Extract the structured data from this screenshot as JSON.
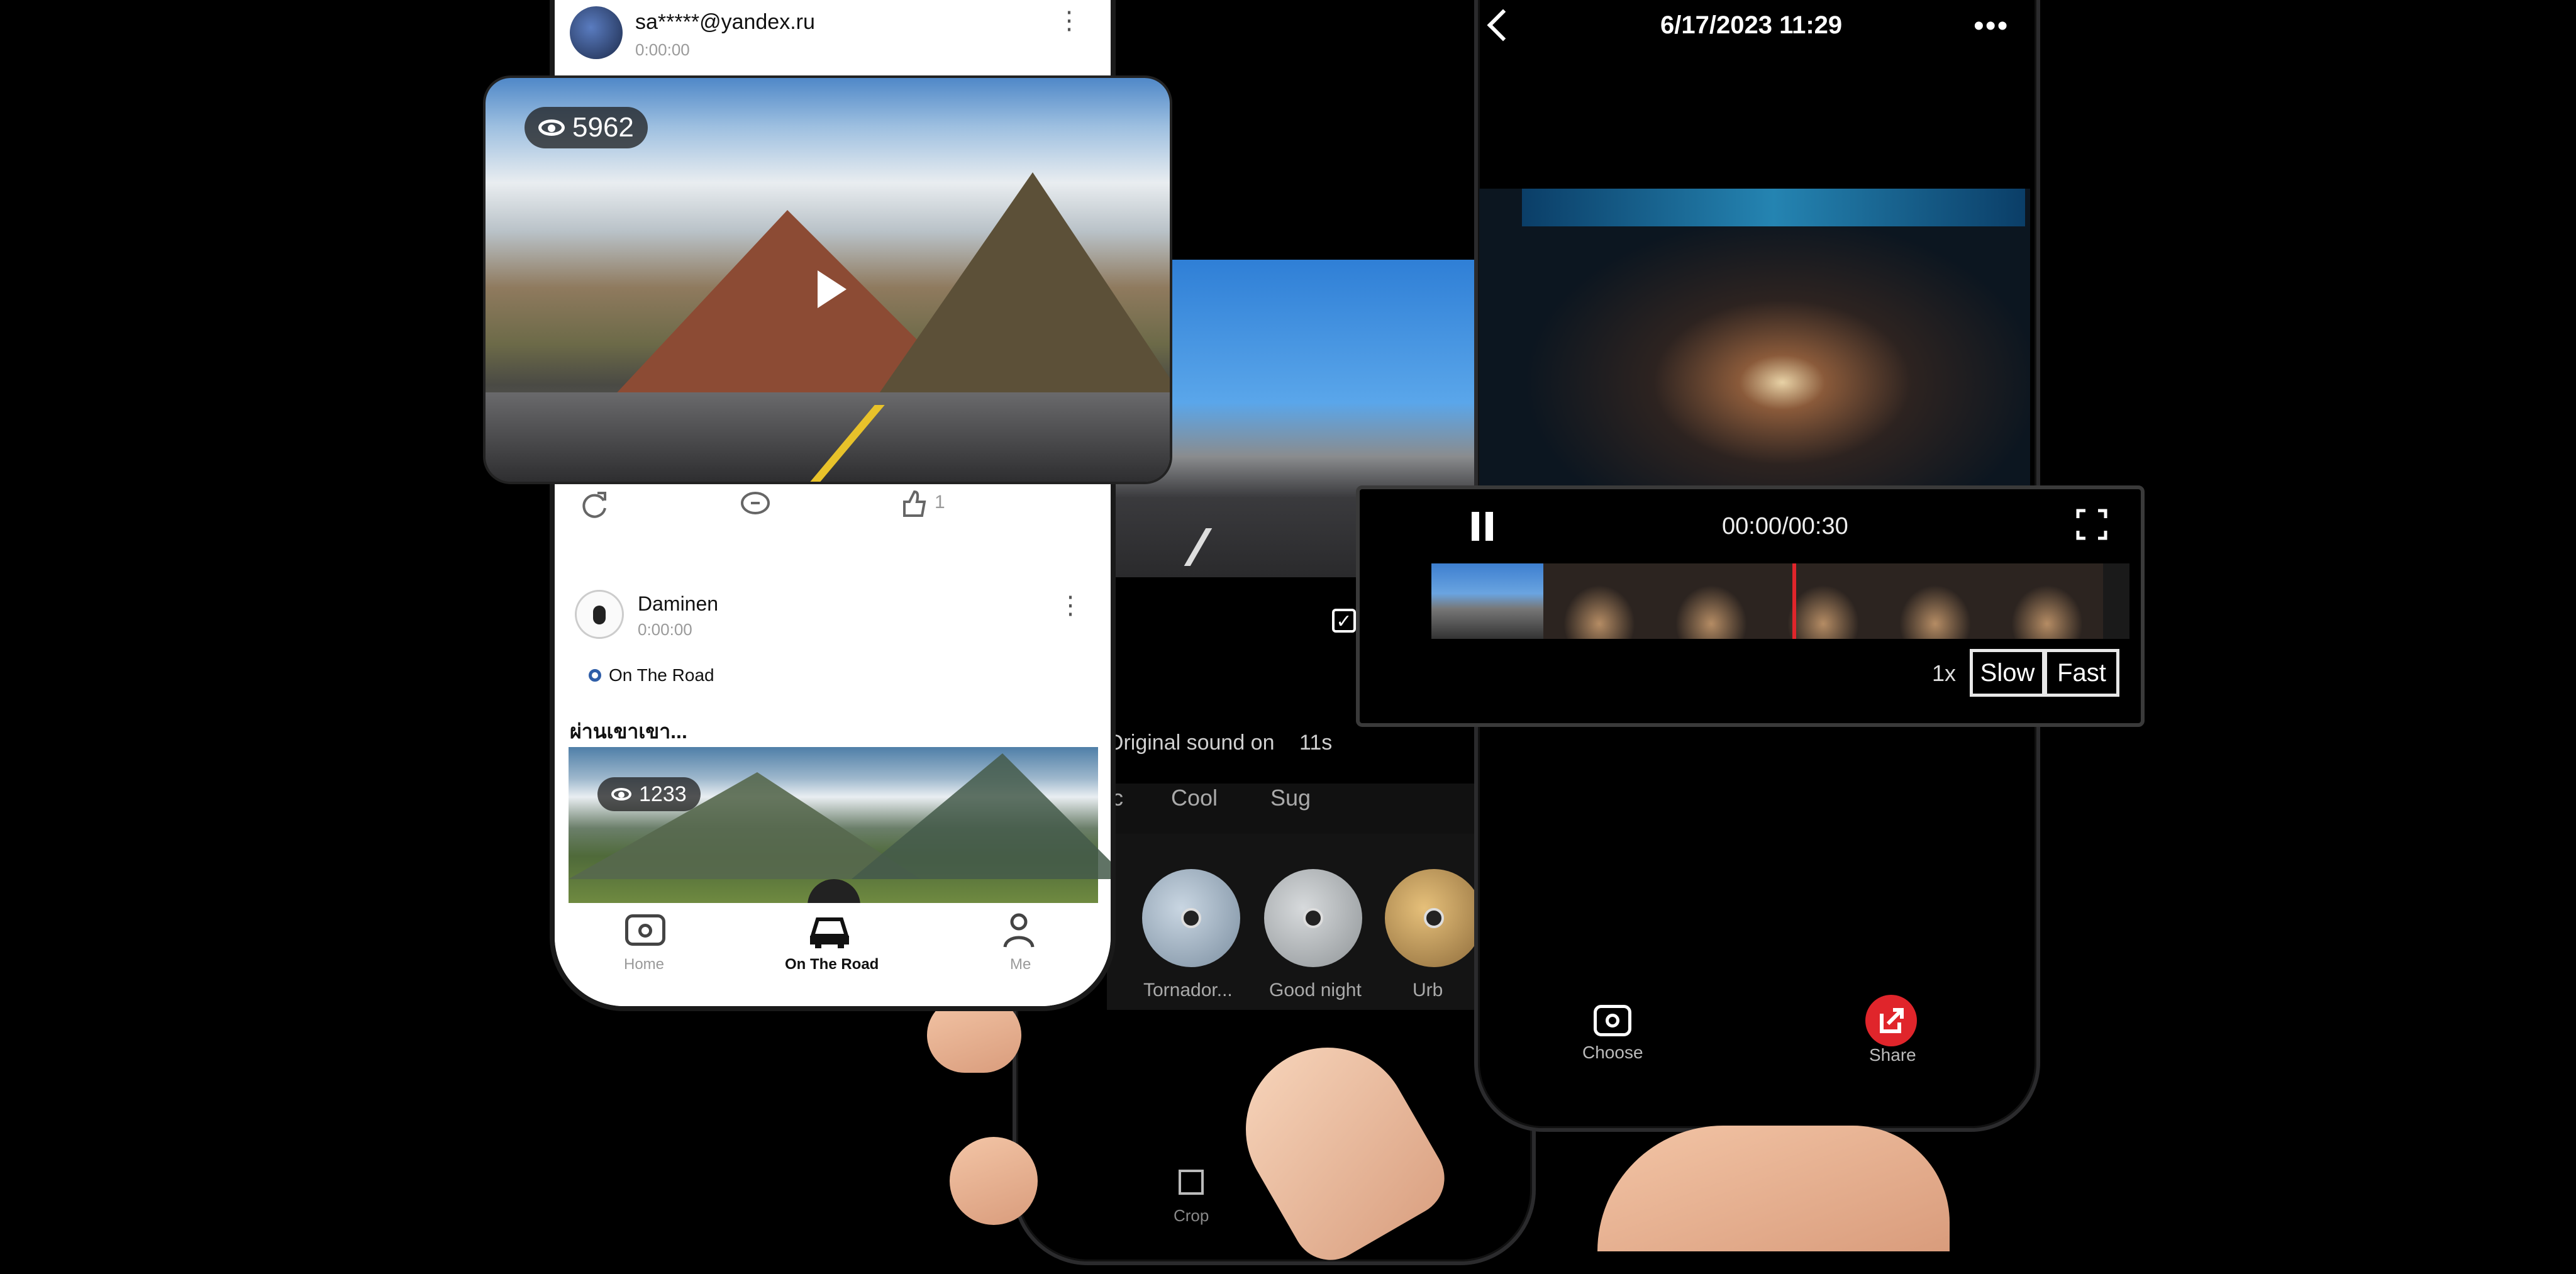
{
  "feed": {
    "post1": {
      "user_name": "sa*****@yandex.ru",
      "user_sub": "0:00:00",
      "views": "5962",
      "likes": "1"
    },
    "post2": {
      "user_name": "Daminen",
      "user_sub": "0:00:00",
      "tag": "On The Road",
      "caption": "ผ่านเขาเขา...",
      "views": "1233"
    },
    "nav": {
      "home": "Home",
      "road": "On The Road",
      "me": "Me"
    }
  },
  "editor": {
    "original_sound": "Original sound on",
    "duration": "11s",
    "tabs": [
      "c",
      "Cool",
      "Sug"
    ],
    "filters": [
      "Tornador...",
      "Good night",
      "Urb"
    ],
    "crop": "Crop"
  },
  "player": {
    "title": "6/17/2023 11:29",
    "time": "00:00/00:30",
    "speed": "1x",
    "slow": "Slow",
    "fast": "Fast",
    "choose": "Choose",
    "share": "Share"
  },
  "colors": {
    "accent_red": "#e0252b",
    "feed_bg": "#ffffff",
    "app_bg": "#000000"
  }
}
